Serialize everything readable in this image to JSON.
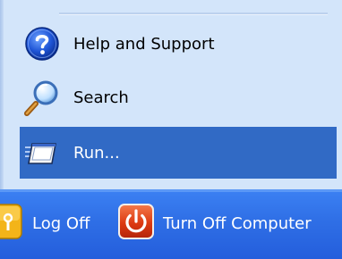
{
  "start_menu": {
    "items": [
      {
        "label": "Help and Support",
        "icon": "help-icon"
      },
      {
        "label": "Search",
        "icon": "search-icon"
      },
      {
        "label": "Run...",
        "icon": "run-icon",
        "selected": true
      }
    ],
    "footer": {
      "log_off_label": "Log Off",
      "turn_off_label": "Turn Off Computer"
    },
    "colors": {
      "pane_bg": "#d3e5fa",
      "selection": "#316ac5",
      "footer_bar": "#2f6fe6"
    }
  }
}
